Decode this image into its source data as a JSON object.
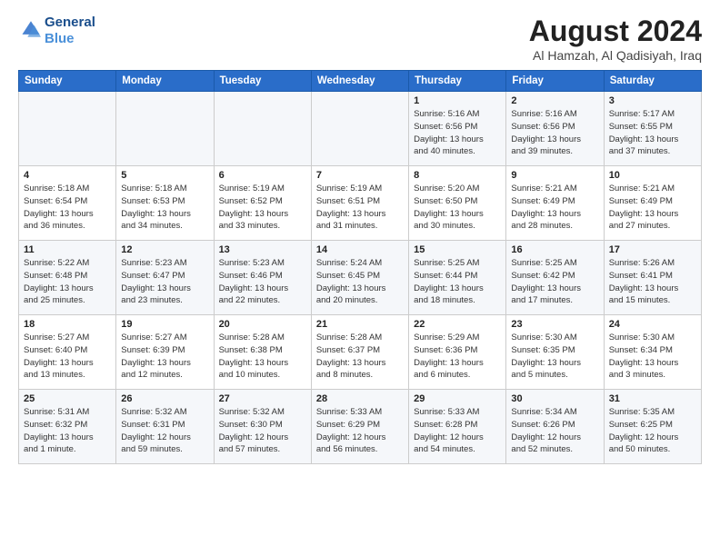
{
  "header": {
    "logo_line1": "General",
    "logo_line2": "Blue",
    "title": "August 2024",
    "subtitle": "Al Hamzah, Al Qadisiyah, Iraq"
  },
  "days_of_week": [
    "Sunday",
    "Monday",
    "Tuesday",
    "Wednesday",
    "Thursday",
    "Friday",
    "Saturday"
  ],
  "weeks": [
    [
      {
        "day": "",
        "info": ""
      },
      {
        "day": "",
        "info": ""
      },
      {
        "day": "",
        "info": ""
      },
      {
        "day": "",
        "info": ""
      },
      {
        "day": "1",
        "info": "Sunrise: 5:16 AM\nSunset: 6:56 PM\nDaylight: 13 hours\nand 40 minutes."
      },
      {
        "day": "2",
        "info": "Sunrise: 5:16 AM\nSunset: 6:56 PM\nDaylight: 13 hours\nand 39 minutes."
      },
      {
        "day": "3",
        "info": "Sunrise: 5:17 AM\nSunset: 6:55 PM\nDaylight: 13 hours\nand 37 minutes."
      }
    ],
    [
      {
        "day": "4",
        "info": "Sunrise: 5:18 AM\nSunset: 6:54 PM\nDaylight: 13 hours\nand 36 minutes."
      },
      {
        "day": "5",
        "info": "Sunrise: 5:18 AM\nSunset: 6:53 PM\nDaylight: 13 hours\nand 34 minutes."
      },
      {
        "day": "6",
        "info": "Sunrise: 5:19 AM\nSunset: 6:52 PM\nDaylight: 13 hours\nand 33 minutes."
      },
      {
        "day": "7",
        "info": "Sunrise: 5:19 AM\nSunset: 6:51 PM\nDaylight: 13 hours\nand 31 minutes."
      },
      {
        "day": "8",
        "info": "Sunrise: 5:20 AM\nSunset: 6:50 PM\nDaylight: 13 hours\nand 30 minutes."
      },
      {
        "day": "9",
        "info": "Sunrise: 5:21 AM\nSunset: 6:49 PM\nDaylight: 13 hours\nand 28 minutes."
      },
      {
        "day": "10",
        "info": "Sunrise: 5:21 AM\nSunset: 6:49 PM\nDaylight: 13 hours\nand 27 minutes."
      }
    ],
    [
      {
        "day": "11",
        "info": "Sunrise: 5:22 AM\nSunset: 6:48 PM\nDaylight: 13 hours\nand 25 minutes."
      },
      {
        "day": "12",
        "info": "Sunrise: 5:23 AM\nSunset: 6:47 PM\nDaylight: 13 hours\nand 23 minutes."
      },
      {
        "day": "13",
        "info": "Sunrise: 5:23 AM\nSunset: 6:46 PM\nDaylight: 13 hours\nand 22 minutes."
      },
      {
        "day": "14",
        "info": "Sunrise: 5:24 AM\nSunset: 6:45 PM\nDaylight: 13 hours\nand 20 minutes."
      },
      {
        "day": "15",
        "info": "Sunrise: 5:25 AM\nSunset: 6:44 PM\nDaylight: 13 hours\nand 18 minutes."
      },
      {
        "day": "16",
        "info": "Sunrise: 5:25 AM\nSunset: 6:42 PM\nDaylight: 13 hours\nand 17 minutes."
      },
      {
        "day": "17",
        "info": "Sunrise: 5:26 AM\nSunset: 6:41 PM\nDaylight: 13 hours\nand 15 minutes."
      }
    ],
    [
      {
        "day": "18",
        "info": "Sunrise: 5:27 AM\nSunset: 6:40 PM\nDaylight: 13 hours\nand 13 minutes."
      },
      {
        "day": "19",
        "info": "Sunrise: 5:27 AM\nSunset: 6:39 PM\nDaylight: 13 hours\nand 12 minutes."
      },
      {
        "day": "20",
        "info": "Sunrise: 5:28 AM\nSunset: 6:38 PM\nDaylight: 13 hours\nand 10 minutes."
      },
      {
        "day": "21",
        "info": "Sunrise: 5:28 AM\nSunset: 6:37 PM\nDaylight: 13 hours\nand 8 minutes."
      },
      {
        "day": "22",
        "info": "Sunrise: 5:29 AM\nSunset: 6:36 PM\nDaylight: 13 hours\nand 6 minutes."
      },
      {
        "day": "23",
        "info": "Sunrise: 5:30 AM\nSunset: 6:35 PM\nDaylight: 13 hours\nand 5 minutes."
      },
      {
        "day": "24",
        "info": "Sunrise: 5:30 AM\nSunset: 6:34 PM\nDaylight: 13 hours\nand 3 minutes."
      }
    ],
    [
      {
        "day": "25",
        "info": "Sunrise: 5:31 AM\nSunset: 6:32 PM\nDaylight: 13 hours\nand 1 minute."
      },
      {
        "day": "26",
        "info": "Sunrise: 5:32 AM\nSunset: 6:31 PM\nDaylight: 12 hours\nand 59 minutes."
      },
      {
        "day": "27",
        "info": "Sunrise: 5:32 AM\nSunset: 6:30 PM\nDaylight: 12 hours\nand 57 minutes."
      },
      {
        "day": "28",
        "info": "Sunrise: 5:33 AM\nSunset: 6:29 PM\nDaylight: 12 hours\nand 56 minutes."
      },
      {
        "day": "29",
        "info": "Sunrise: 5:33 AM\nSunset: 6:28 PM\nDaylight: 12 hours\nand 54 minutes."
      },
      {
        "day": "30",
        "info": "Sunrise: 5:34 AM\nSunset: 6:26 PM\nDaylight: 12 hours\nand 52 minutes."
      },
      {
        "day": "31",
        "info": "Sunrise: 5:35 AM\nSunset: 6:25 PM\nDaylight: 12 hours\nand 50 minutes."
      }
    ]
  ]
}
